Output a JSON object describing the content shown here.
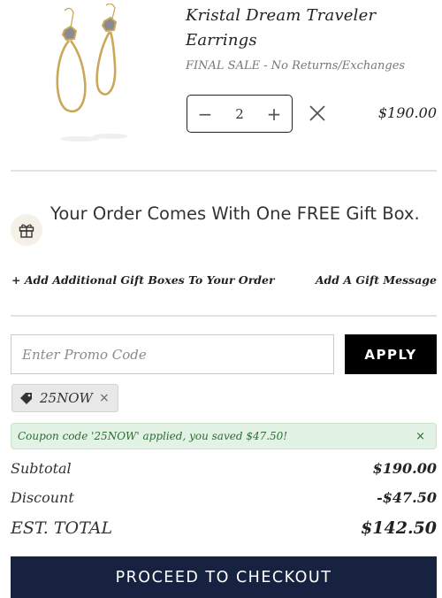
{
  "product": {
    "title": "Kristal Dream Traveler Earrings",
    "sale_note": "FINAL SALE - No Returns/Exchanges",
    "quantity": "2",
    "price": "$190.00",
    "image_icon": "earrings-product-image"
  },
  "quantity_controls": {
    "decrement_label": "−",
    "increment_label": "+",
    "remove_icon": "close-icon"
  },
  "gift": {
    "icon": "gift-icon",
    "message": "Your Order Comes With One FREE Gift Box.",
    "add_boxes_link": "+ Add Additional Gift Boxes To Your Order",
    "gift_message_link": "Add A Gift Message"
  },
  "promo": {
    "placeholder": "Enter Promo Code",
    "value": "",
    "apply_label": "APPLY"
  },
  "applied_coupon": {
    "icon": "tag-icon",
    "code": "25NOW",
    "remove_label": "×"
  },
  "alert": {
    "message": "Coupon code '25NOW' applied, you saved $47.50!",
    "close_label": "×"
  },
  "summary": {
    "subtotal_label": "Subtotal",
    "subtotal_value": "$190.00",
    "discount_label": "Discount",
    "discount_value": "-$47.50",
    "total_label": "EST. TOTAL",
    "total_value": "$142.50"
  },
  "checkout": {
    "label": "PROCEED TO CHECKOUT"
  },
  "colors": {
    "checkout_bg": "#16223f",
    "apply_bg": "#000000",
    "alert_bg": "#e2f2e4",
    "alert_text": "#2e6b36",
    "gold": "#c9a85a"
  }
}
